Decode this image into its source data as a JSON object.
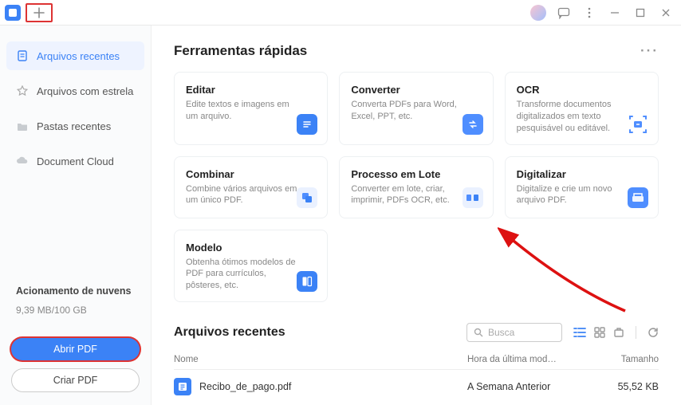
{
  "sidebar": {
    "items": [
      {
        "label": "Arquivos recentes"
      },
      {
        "label": "Arquivos com estrela"
      },
      {
        "label": "Pastas recentes"
      },
      {
        "label": "Document Cloud"
      }
    ],
    "cloud": {
      "title": "Acionamento de nuvens",
      "usage": "9,39 MB/100 GB"
    },
    "open_pdf": "Abrir PDF",
    "create_pdf": "Criar PDF"
  },
  "main": {
    "tools_title": "Ferramentas rápidas",
    "cards": [
      {
        "title": "Editar",
        "sub": "Edite textos e imagens em um arquivo."
      },
      {
        "title": "Converter",
        "sub": "Converta PDFs para Word, Excel, PPT, etc."
      },
      {
        "title": "OCR",
        "sub": "Transforme documentos digitalizados em texto pesquisável ou editável."
      },
      {
        "title": "Combinar",
        "sub": "Combine vários arquivos em um único PDF."
      },
      {
        "title": "Processo em Lote",
        "sub": "Converter em lote, criar, imprimir, PDFs OCR, etc."
      },
      {
        "title": "Digitalizar",
        "sub": "Digitalize e crie um novo arquivo PDF."
      },
      {
        "title": "Modelo",
        "sub": "Obtenha ótimos modelos de PDF para currículos, pôsteres, etc."
      }
    ],
    "recent_title": "Arquivos recentes",
    "search_placeholder": "Busca",
    "columns": {
      "name": "Nome",
      "date": "Hora da última mod…",
      "size": "Tamanho"
    },
    "files": [
      {
        "name": "Recibo_de_pago.pdf",
        "date": "A Semana Anterior",
        "size": "55,52 KB"
      }
    ]
  }
}
